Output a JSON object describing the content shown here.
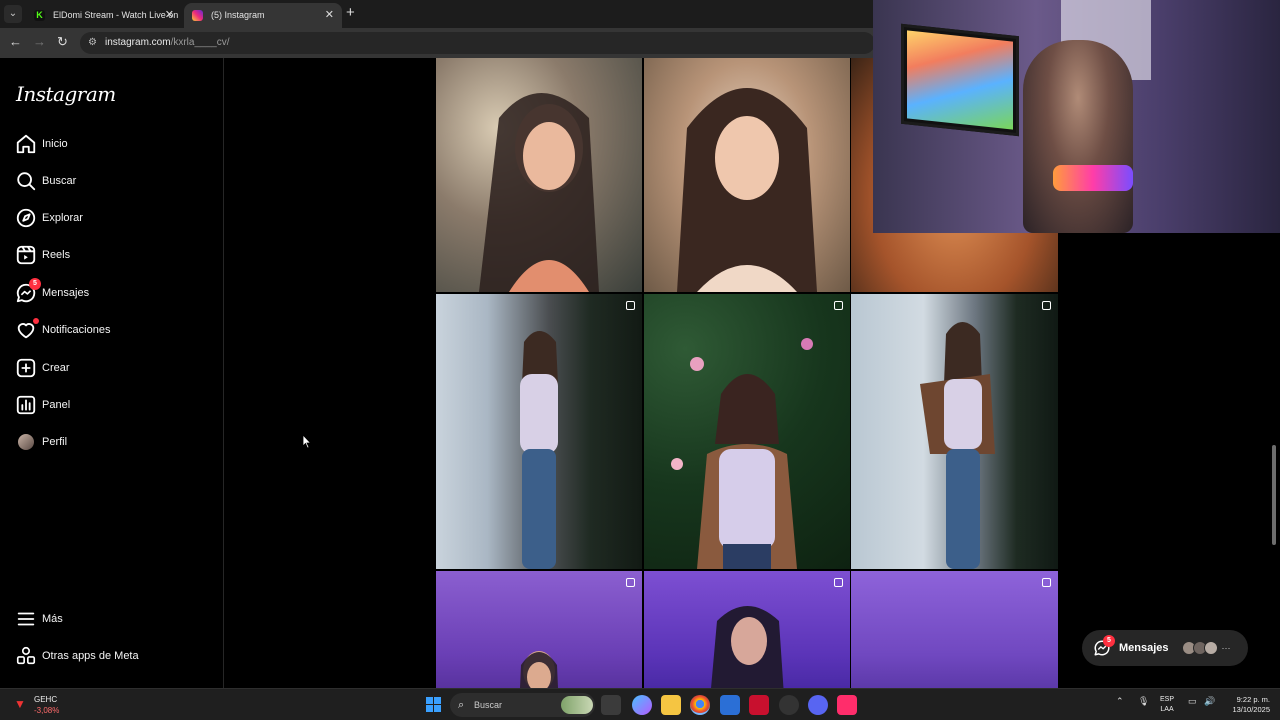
{
  "browser": {
    "tabs": [
      {
        "title": "ElDomi Stream - Watch Live on",
        "favicon": "kick-icon"
      },
      {
        "title": "(5) Instagram",
        "favicon": "instagram-icon"
      }
    ],
    "url": {
      "host": "instagram.com",
      "path": "/kxrla____cv/"
    }
  },
  "instagram": {
    "logo": "Instagram",
    "nav": [
      {
        "label": "Inicio",
        "icon": "home-icon"
      },
      {
        "label": "Buscar",
        "icon": "search-icon"
      },
      {
        "label": "Explorar",
        "icon": "compass-icon"
      },
      {
        "label": "Reels",
        "icon": "reels-icon"
      },
      {
        "label": "Mensajes",
        "icon": "messenger-icon",
        "badge": "5"
      },
      {
        "label": "Notificaciones",
        "icon": "heart-icon",
        "dot": true
      },
      {
        "label": "Crear",
        "icon": "plus-square-icon"
      },
      {
        "label": "Panel",
        "icon": "bar-chart-icon"
      },
      {
        "label": "Perfil",
        "icon": "avatar-icon"
      }
    ],
    "bottom_nav": [
      {
        "label": "Más",
        "icon": "menu-icon"
      },
      {
        "label": "Otras apps de Meta",
        "icon": "meta-apps-icon"
      }
    ],
    "messages_pill": {
      "label": "Mensajes",
      "badge": "5"
    }
  },
  "taskbar": {
    "weather": {
      "line1": "GEHC",
      "line2": "-3,08%"
    },
    "search_placeholder": "Buscar",
    "lang": {
      "line1": "ESP",
      "line2": "LAA"
    },
    "clock": {
      "time": "9:22 p. m.",
      "date": "13/10/2025"
    }
  },
  "colors": {
    "accent": "#ff3040",
    "background": "#000000",
    "chrome_dark": "#353535"
  }
}
